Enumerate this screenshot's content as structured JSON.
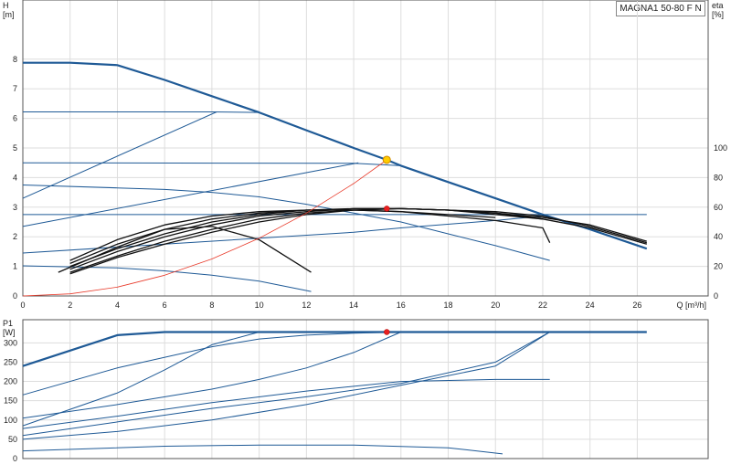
{
  "model_label": "MAGNA1 50-80 F N",
  "colors": {
    "curve": "#1f5a96",
    "eff": "#111111",
    "system": "#e83a2a",
    "duty": "#ffcc00",
    "grid": "#dddddd",
    "axis": "#555555"
  },
  "chart_data": [
    {
      "type": "line",
      "name": "head",
      "xlabel": "Q [m³/h]",
      "ylabel_left": "H\n[m]",
      "ylabel_right": "eta\n[%]",
      "xlim": [
        0,
        29
      ],
      "ylim": [
        0,
        10
      ],
      "eta_lim": [
        0,
        200
      ],
      "x_ticks": [
        "0",
        "2",
        "4",
        "6",
        "8",
        "10",
        "12",
        "14",
        "16",
        "18",
        "20",
        "22",
        "24",
        "26"
      ],
      "y_ticks": [
        "0",
        "1",
        "2",
        "3",
        "4",
        "5",
        "6",
        "7",
        "8"
      ],
      "eta_ticks": [
        "0",
        "20",
        "40",
        "60",
        "80",
        "100"
      ],
      "series": [
        {
          "kind": "head",
          "bold": true,
          "points": [
            [
              0,
              7.88
            ],
            [
              2,
              7.88
            ],
            [
              4,
              7.8
            ],
            [
              6,
              7.3
            ],
            [
              8,
              6.75
            ],
            [
              10,
              6.2
            ],
            [
              12,
              5.6
            ],
            [
              14,
              5.0
            ],
            [
              15.4,
              4.6
            ],
            [
              16,
              4.4
            ],
            [
              18,
              3.85
            ],
            [
              20,
              3.3
            ],
            [
              22,
              2.75
            ],
            [
              24,
              2.25
            ],
            [
              26.4,
              1.6
            ]
          ]
        },
        {
          "kind": "head",
          "bold": false,
          "points": [
            [
              0,
              6.22
            ],
            [
              8,
              6.22
            ],
            [
              10,
              6.2
            ]
          ]
        },
        {
          "kind": "head",
          "bold": false,
          "points": [
            [
              0,
              3.3
            ],
            [
              8.2,
              6.22
            ]
          ]
        },
        {
          "kind": "head",
          "bold": false,
          "points": [
            [
              0,
              4.5
            ],
            [
              14,
              4.48
            ],
            [
              16,
              4.4
            ]
          ]
        },
        {
          "kind": "head",
          "bold": false,
          "points": [
            [
              0,
              2.35
            ],
            [
              14.2,
              4.5
            ]
          ]
        },
        {
          "kind": "head",
          "bold": false,
          "points": [
            [
              0,
              3.75
            ],
            [
              4,
              3.65
            ],
            [
              6,
              3.6
            ],
            [
              8,
              3.5
            ],
            [
              10,
              3.35
            ],
            [
              12,
              3.1
            ],
            [
              14,
              2.8
            ],
            [
              16,
              2.5
            ],
            [
              18,
              2.1
            ],
            [
              20,
              1.7
            ],
            [
              22.3,
              1.2
            ]
          ]
        },
        {
          "kind": "head",
          "bold": false,
          "points": [
            [
              0,
              2.75
            ],
            [
              26.4,
              2.75
            ]
          ]
        },
        {
          "kind": "head",
          "bold": false,
          "points": [
            [
              0,
              1.45
            ],
            [
              6,
              1.75
            ],
            [
              10,
              1.95
            ],
            [
              14,
              2.15
            ],
            [
              16,
              2.3
            ],
            [
              20,
              2.55
            ],
            [
              22,
              2.7
            ]
          ]
        },
        {
          "kind": "head",
          "bold": false,
          "points": [
            [
              0,
              1.02
            ],
            [
              4,
              0.95
            ],
            [
              6,
              0.85
            ],
            [
              8,
              0.7
            ],
            [
              10,
              0.5
            ],
            [
              12.2,
              0.15
            ]
          ]
        },
        {
          "kind": "eta",
          "points": [
            [
              2,
              24
            ],
            [
              4,
              38
            ],
            [
              6,
              48
            ],
            [
              8,
              54
            ],
            [
              10,
              57
            ],
            [
              12,
              58
            ],
            [
              14,
              58
            ],
            [
              16,
              57
            ],
            [
              18,
              54
            ],
            [
              20,
              51
            ],
            [
              22,
              46
            ],
            [
              22.3,
              36
            ]
          ]
        },
        {
          "kind": "eta",
          "points": [
            [
              2,
              22
            ],
            [
              4,
              35
            ],
            [
              6,
              45
            ],
            [
              8,
              52
            ],
            [
              10,
              56
            ],
            [
              12,
              58
            ],
            [
              14,
              58
            ],
            [
              16,
              57
            ],
            [
              18,
              55
            ],
            [
              20,
              53
            ]
          ]
        },
        {
          "kind": "eta",
          "points": [
            [
              2,
              20
            ],
            [
              4,
              32
            ],
            [
              6,
              42
            ],
            [
              8,
              50
            ],
            [
              10,
              55
            ],
            [
              12,
              58
            ],
            [
              14,
              59
            ],
            [
              16,
              59
            ],
            [
              18,
              58
            ],
            [
              20,
              55
            ],
            [
              22,
              52
            ]
          ]
        },
        {
          "kind": "eta",
          "points": [
            [
              2,
              18
            ],
            [
              4,
              30
            ],
            [
              6,
              40
            ],
            [
              8,
              48
            ],
            [
              10,
              54
            ],
            [
              12,
              57
            ],
            [
              14,
              59
            ],
            [
              16,
              59
            ],
            [
              18,
              58
            ],
            [
              20,
              56
            ],
            [
              22,
              53
            ],
            [
              24,
              48
            ],
            [
              26.4,
              37
            ]
          ]
        },
        {
          "kind": "eta",
          "points": [
            [
              2,
              16
            ],
            [
              4,
              27
            ],
            [
              6,
              37
            ],
            [
              8,
              45
            ],
            [
              10,
              52
            ],
            [
              12,
              56
            ],
            [
              14,
              58
            ],
            [
              16,
              59
            ],
            [
              18,
              58
            ],
            [
              20,
              56
            ],
            [
              22,
              52
            ],
            [
              24,
              46
            ],
            [
              26.4,
              35
            ]
          ]
        },
        {
          "kind": "eta",
          "points": [
            [
              2,
              15
            ],
            [
              4,
              26
            ],
            [
              6,
              35
            ],
            [
              8,
              43
            ],
            [
              10,
              50
            ],
            [
              12,
              55
            ],
            [
              14,
              58
            ],
            [
              16,
              59
            ],
            [
              18,
              58
            ],
            [
              20,
              57
            ],
            [
              22,
              54
            ],
            [
              24,
              47
            ],
            [
              26.4,
              36
            ]
          ]
        },
        {
          "kind": "eta",
          "points": [
            [
              1.5,
              16
            ],
            [
              4,
              33
            ],
            [
              6,
              45
            ],
            [
              8,
              47
            ],
            [
              10,
              38
            ],
            [
              12.2,
              16
            ]
          ]
        },
        {
          "kind": "system",
          "points": [
            [
              0,
              0
            ],
            [
              2,
              0.07
            ],
            [
              4,
              0.3
            ],
            [
              6,
              0.7
            ],
            [
              8,
              1.25
            ],
            [
              10,
              1.95
            ],
            [
              12,
              2.8
            ],
            [
              14,
              3.8
            ],
            [
              15.4,
              4.6
            ]
          ]
        }
      ],
      "duty_point": {
        "q": 15.4,
        "h": 4.6
      },
      "eta_point": {
        "q": 15.4,
        "eta": 59
      }
    },
    {
      "type": "line",
      "name": "power",
      "ylabel": "P1\n[W]",
      "xlim": [
        0,
        29
      ],
      "ylim": [
        0,
        360
      ],
      "y_ticks": [
        "0",
        "50",
        "100",
        "150",
        "200",
        "250",
        "300"
      ],
      "series": [
        {
          "kind": "power",
          "bold": true,
          "points": [
            [
              0,
              240
            ],
            [
              2,
              280
            ],
            [
              4,
              320
            ],
            [
              6,
              328
            ],
            [
              26.4,
              328
            ]
          ]
        },
        {
          "kind": "power",
          "bold": false,
          "points": [
            [
              0,
              165
            ],
            [
              4,
              235
            ],
            [
              8,
              290
            ],
            [
              10,
              310
            ],
            [
              12,
              320
            ],
            [
              14,
              325
            ],
            [
              16,
              328
            ]
          ]
        },
        {
          "kind": "power",
          "bold": false,
          "points": [
            [
              0,
              85
            ],
            [
              4,
              170
            ],
            [
              6,
              230
            ],
            [
              8,
              295
            ],
            [
              10,
              328
            ]
          ]
        },
        {
          "kind": "power",
          "bold": false,
          "points": [
            [
              0,
              105
            ],
            [
              4,
              140
            ],
            [
              8,
              180
            ],
            [
              10,
              205
            ],
            [
              12,
              235
            ],
            [
              14,
              275
            ],
            [
              16,
              328
            ]
          ]
        },
        {
          "kind": "power",
          "bold": false,
          "points": [
            [
              0,
              78
            ],
            [
              4,
              110
            ],
            [
              8,
              145
            ],
            [
              12,
              175
            ],
            [
              16,
              200
            ],
            [
              20,
              205
            ],
            [
              22.3,
              205
            ]
          ]
        },
        {
          "kind": "power",
          "bold": false,
          "points": [
            [
              0,
              60
            ],
            [
              4,
              95
            ],
            [
              8,
              130
            ],
            [
              12,
              160
            ],
            [
              16,
              195
            ],
            [
              20,
              250
            ],
            [
              22.3,
              328
            ]
          ]
        },
        {
          "kind": "power",
          "bold": false,
          "points": [
            [
              0,
              50
            ],
            [
              4,
              70
            ],
            [
              8,
              100
            ],
            [
              12,
              140
            ],
            [
              16,
              190
            ],
            [
              20,
              240
            ],
            [
              22.3,
              328
            ]
          ]
        },
        {
          "kind": "power",
          "bold": false,
          "points": [
            [
              0,
              20
            ],
            [
              6,
              32
            ],
            [
              10,
              35
            ],
            [
              14,
              35
            ],
            [
              18,
              28
            ],
            [
              20.3,
              12
            ]
          ]
        }
      ],
      "duty_point": {
        "q": 15.4,
        "p": 328
      }
    }
  ]
}
